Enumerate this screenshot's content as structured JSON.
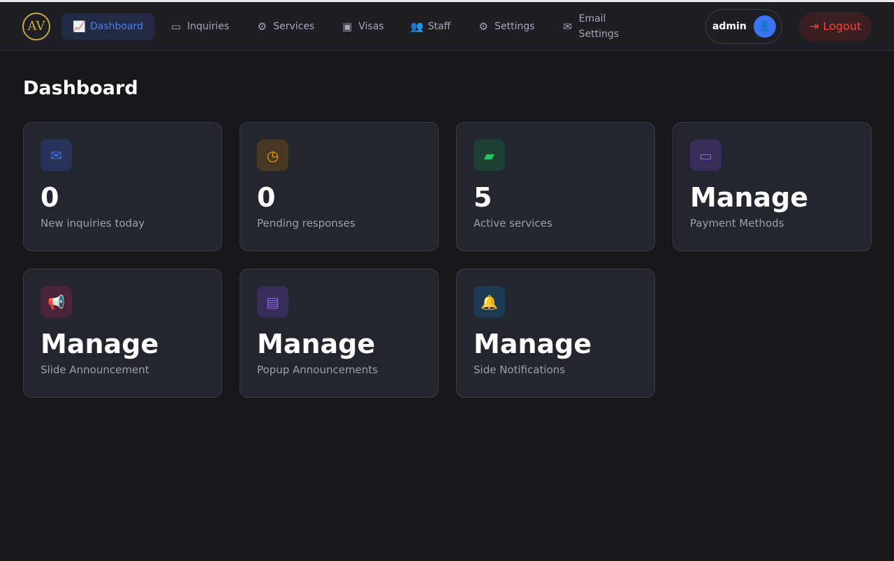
{
  "nav": {
    "logo_text": "AV",
    "items": [
      {
        "label": "Dashboard",
        "icon": "chart-line-icon",
        "glyph": "📈",
        "active": true
      },
      {
        "label": "Inquiries",
        "icon": "inbox-icon",
        "glyph": "▭"
      },
      {
        "label": "Services",
        "icon": "cogs-icon",
        "glyph": "⚙"
      },
      {
        "label": "Visas",
        "icon": "passport-icon",
        "glyph": "▣"
      },
      {
        "label": "Staff",
        "icon": "users-icon",
        "glyph": "👥"
      },
      {
        "label": "Settings",
        "icon": "gear-icon",
        "glyph": "⚙"
      },
      {
        "label": "Email Settings",
        "icon": "envelope-open-icon",
        "glyph": "✉"
      }
    ],
    "user": "admin",
    "logout": "Logout"
  },
  "page_title": "Dashboard",
  "cards": [
    {
      "value": "0",
      "label": "New inquiries today",
      "icon": "envelope-icon",
      "glyph": "✉",
      "bg": "#273258",
      "fg": "#3b6ef5"
    },
    {
      "value": "0",
      "label": "Pending responses",
      "icon": "clock-icon",
      "glyph": "◷",
      "bg": "#483823",
      "fg": "#f59e0b"
    },
    {
      "value": "5",
      "label": "Active services",
      "icon": "briefcase-icon",
      "glyph": "▰",
      "bg": "#1e4033",
      "fg": "#22c55e"
    },
    {
      "value": "Manage",
      "label": "Payment Methods",
      "icon": "credit-card-icon",
      "glyph": "▭",
      "bg": "#382c58",
      "fg": "#8b5cf6"
    },
    {
      "value": "Manage",
      "label": "Slide Announcement",
      "icon": "bullhorn-icon",
      "glyph": "📢",
      "bg": "#4a2438",
      "fg": "#ec4899"
    },
    {
      "value": "Manage",
      "label": "Popup Announcements",
      "icon": "window-icon",
      "glyph": "▤",
      "bg": "#382c58",
      "fg": "#8b5cf6"
    },
    {
      "value": "Manage",
      "label": "Side Notifications",
      "icon": "bell-icon",
      "glyph": "🔔",
      "bg": "#1d3a50",
      "fg": "#0ea5e9"
    }
  ]
}
